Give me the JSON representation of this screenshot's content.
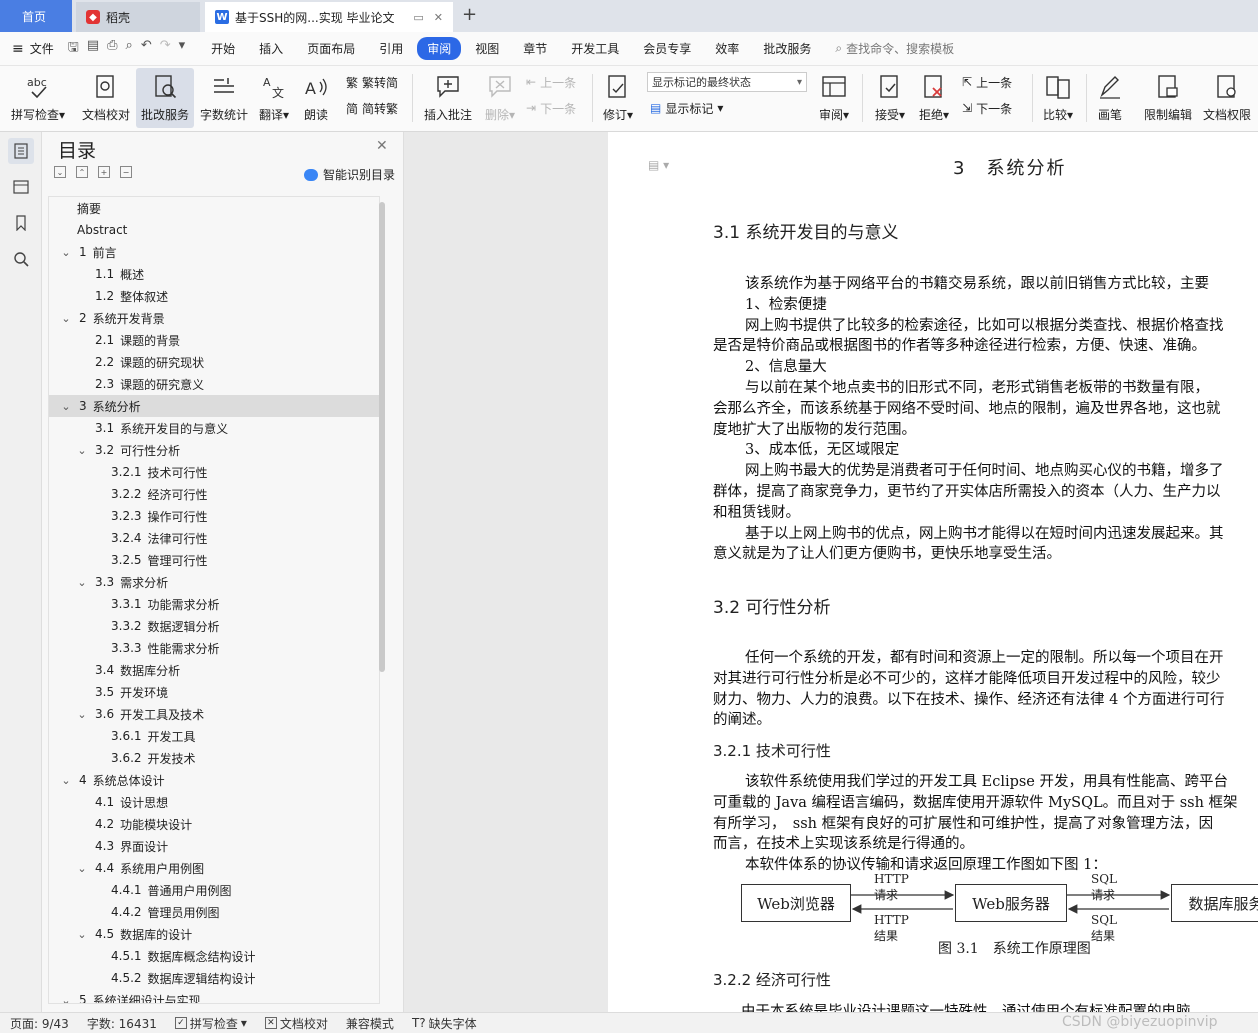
{
  "tabs": {
    "home": "首页",
    "daoke": "稻壳",
    "doc": "基于SSH的网...实现 毕业论文"
  },
  "menu": {
    "file": "文件",
    "items": [
      "开始",
      "插入",
      "页面布局",
      "引用",
      "审阅",
      "视图",
      "章节",
      "开发工具",
      "会员专享",
      "效率",
      "批改服务"
    ],
    "active": "审阅",
    "search": "查找命令、搜索模板"
  },
  "ribbon": {
    "spell": "拼写检查",
    "doc_check": "文档校对",
    "correction": "批改服务",
    "word_count": "字数统计",
    "translate": "翻译",
    "read": "朗读",
    "trad": "繁转简",
    "simp": "简转繁",
    "insert_comment": "插入批注",
    "delete": "删除",
    "prev_comment": "上一条",
    "next_comment": "下一条",
    "revise": "修订",
    "markup_state": "显示标记的最终状态",
    "show_markup": "显示标记",
    "review": "审阅",
    "accept": "接受",
    "reject": "拒绝",
    "prev_change": "上一条",
    "next_change": "下一条",
    "compare": "比较",
    "pen": "画笔",
    "restrict": "限制编辑",
    "rights": "文档权限"
  },
  "toc": {
    "title": "目录",
    "smart": "智能识别目录",
    "items": [
      {
        "level": 0,
        "num": "",
        "text": "摘要",
        "chev": false,
        "sel": false
      },
      {
        "level": 0,
        "num": "",
        "text": "Abstract",
        "chev": false,
        "sel": false
      },
      {
        "level": 0,
        "num": "1",
        "text": "前言",
        "chev": true,
        "sel": false
      },
      {
        "level": 1,
        "num": "1.1",
        "text": "概述",
        "chev": false,
        "sel": false
      },
      {
        "level": 1,
        "num": "1.2",
        "text": "整体叙述",
        "chev": false,
        "sel": false
      },
      {
        "level": 0,
        "num": "2",
        "text": "系统开发背景",
        "chev": true,
        "sel": false
      },
      {
        "level": 1,
        "num": "2.1",
        "text": "课题的背景",
        "chev": false,
        "sel": false
      },
      {
        "level": 1,
        "num": "2.2",
        "text": "课题的研究现状",
        "chev": false,
        "sel": false
      },
      {
        "level": 1,
        "num": "2.3",
        "text": "课题的研究意义",
        "chev": false,
        "sel": false
      },
      {
        "level": 0,
        "num": "3",
        "text": "系统分析",
        "chev": true,
        "sel": true
      },
      {
        "level": 1,
        "num": "3.1",
        "text": "系统开发目的与意义",
        "chev": false,
        "sel": false
      },
      {
        "level": 1,
        "num": "3.2",
        "text": "可行性分析",
        "chev": true,
        "sel": false
      },
      {
        "level": 2,
        "num": "3.2.1",
        "text": "技术可行性",
        "chev": false,
        "sel": false
      },
      {
        "level": 2,
        "num": "3.2.2",
        "text": "经济可行性",
        "chev": false,
        "sel": false
      },
      {
        "level": 2,
        "num": "3.2.3",
        "text": "操作可行性",
        "chev": false,
        "sel": false
      },
      {
        "level": 2,
        "num": "3.2.4",
        "text": "法律可行性",
        "chev": false,
        "sel": false
      },
      {
        "level": 2,
        "num": "3.2.5",
        "text": "管理可行性",
        "chev": false,
        "sel": false
      },
      {
        "level": 1,
        "num": "3.3",
        "text": "需求分析",
        "chev": true,
        "sel": false
      },
      {
        "level": 2,
        "num": "3.3.1",
        "text": "功能需求分析",
        "chev": false,
        "sel": false
      },
      {
        "level": 2,
        "num": "3.3.2",
        "text": "数据逻辑分析",
        "chev": false,
        "sel": false
      },
      {
        "level": 2,
        "num": "3.3.3",
        "text": "性能需求分析",
        "chev": false,
        "sel": false
      },
      {
        "level": 1,
        "num": "3.4",
        "text": "数据库分析",
        "chev": false,
        "sel": false
      },
      {
        "level": 1,
        "num": "3.5",
        "text": "开发环境",
        "chev": false,
        "sel": false
      },
      {
        "level": 1,
        "num": "3.6",
        "text": "开发工具及技术",
        "chev": true,
        "sel": false
      },
      {
        "level": 2,
        "num": "3.6.1",
        "text": "开发工具",
        "chev": false,
        "sel": false
      },
      {
        "level": 2,
        "num": "3.6.2",
        "text": "开发技术",
        "chev": false,
        "sel": false
      },
      {
        "level": 0,
        "num": "4",
        "text": "系统总体设计",
        "chev": true,
        "sel": false
      },
      {
        "level": 1,
        "num": "4.1",
        "text": "设计思想",
        "chev": false,
        "sel": false
      },
      {
        "level": 1,
        "num": "4.2",
        "text": "功能模块设计",
        "chev": false,
        "sel": false
      },
      {
        "level": 1,
        "num": "4.3",
        "text": "界面设计",
        "chev": false,
        "sel": false
      },
      {
        "level": 1,
        "num": "4.4",
        "text": "系统用户用例图",
        "chev": true,
        "sel": false
      },
      {
        "level": 2,
        "num": "4.4.1",
        "text": "普通用户用例图",
        "chev": false,
        "sel": false
      },
      {
        "level": 2,
        "num": "4.4.2",
        "text": "管理员用例图",
        "chev": false,
        "sel": false
      },
      {
        "level": 1,
        "num": "4.5",
        "text": "数据库的设计",
        "chev": true,
        "sel": false
      },
      {
        "level": 2,
        "num": "4.5.1",
        "text": "数据库概念结构设计",
        "chev": false,
        "sel": false
      },
      {
        "level": 2,
        "num": "4.5.2",
        "text": "数据库逻辑结构设计",
        "chev": false,
        "sel": false
      },
      {
        "level": 0,
        "num": "5",
        "text": "系统详细设计与实现",
        "chev": true,
        "sel": false
      }
    ]
  },
  "document": {
    "chapter": "3　系统分析",
    "s31": "3.1 系统开发目的与意义",
    "s31_lines": [
      "该系统作为基于网络平台的书籍交易系统，跟以前旧销售方式比较，主要",
      "1、检索便捷",
      "网上购书提供了比较多的检索途径，比如可以根据分类查找、根据价格查找",
      "是否是特价商品或根据图书的作者等多种途径进行检索，方便、快速、准确。",
      "2、信息量大",
      "与以前在某个地点卖书的旧形式不同，老形式销售老板带的书数量有限，",
      "会那么齐全，而该系统基于网络不受时间、地点的限制，遍及世界各地，这也就",
      "度地扩大了出版物的发行范围。",
      "3、成本低，无区域限定",
      "网上购书最大的优势是消费者可于任何时间、地点购买心仪的书籍，增多了",
      "群体，提高了商家竞争力，更节约了开实体店所需投入的资本（人力、生产力以",
      "和租赁钱财。",
      "基于以上网上购书的优点，网上购书才能得以在短时间内迅速发展起来。其",
      "意义就是为了让人们更方便购书，更快乐地享受生活。"
    ],
    "s32": "3.2 可行性分析",
    "s32_lines": [
      "任何一个系统的开发，都有时间和资源上一定的限制。所以每一个项目在开",
      "对其进行可行性分析是必不可少的，这样才能降低项目开发过程中的风险，较少",
      "财力、物力、人力的浪费。以下在技术、操作、经济还有法律 4 个方面进行可行",
      "的阐述。"
    ],
    "s321": "3.2.1 技术可行性",
    "s321_lines": [
      "该软件系统使用我们学过的开发工具 Eclipse 开发，用具有性能高、跨平台",
      "可重载的 Java 编程语言编码，数据库使用开源软件 MySQL。而且对于 ssh 框架",
      "有所学习，　ssh 框架有良好的可扩展性和可维护性，提高了对象管理方法，因",
      "而言，在技术上实现该系统是行得通的。",
      "本软件体系的协议传输和请求返回原理工作图如下图 1："
    ],
    "diagram": {
      "browser": "Web浏览器",
      "server": "Web服务器",
      "db": "数据库服务",
      "http_req": "HTTP请求",
      "http_res": "HTTP结果",
      "sql_req": "SQL请求",
      "sql_res": "SQL结果",
      "caption": "图 3.1　系统工作原理图"
    },
    "s322": "3.2.2 经济可行性",
    "s322_line": "由于本系统是毕业设计课题这一特殊性，通过使用个有标准配置的电脑，"
  },
  "status": {
    "page": "页面: 9/43",
    "words": "字数: 16431",
    "spell": "拼写检查",
    "doc_check": "文档校对",
    "compat": "兼容模式",
    "font": "缺失字体"
  },
  "watermark": "CSDN @biyezuopinvip"
}
